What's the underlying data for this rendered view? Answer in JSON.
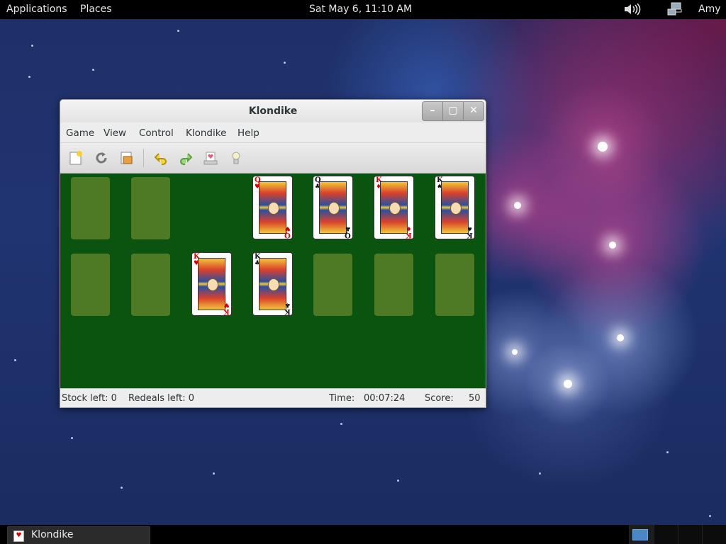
{
  "topbar": {
    "applications": "Applications",
    "places": "Places",
    "clock": "Sat May  6, 11:10 AM",
    "user": "Amy",
    "volume_icon": "volume-icon",
    "network_icon": "network-icon"
  },
  "window": {
    "title": "Klondike",
    "controls": {
      "minimize": "–",
      "maximize": "▢",
      "close": "✕"
    },
    "menu": [
      "Game",
      "View",
      "Control",
      "Klondike",
      "Help"
    ],
    "toolbar": [
      "new-game-icon",
      "restart-icon",
      "select-game-icon",
      "undo-icon",
      "redo-icon",
      "deal-icon",
      "hint-icon"
    ],
    "cards": {
      "foundation_1": {
        "rank": "Q",
        "suit": "♥",
        "color": "red"
      },
      "foundation_2": {
        "rank": "Q",
        "suit": "♣",
        "color": "black"
      },
      "foundation_3": {
        "rank": "K",
        "suit": "♦",
        "color": "red"
      },
      "foundation_4": {
        "rank": "K",
        "suit": "♠",
        "color": "black"
      },
      "tableau_3": {
        "rank": "K",
        "suit": "♥",
        "color": "red"
      },
      "tableau_4": {
        "rank": "K",
        "suit": "♣",
        "color": "black"
      }
    },
    "status": {
      "stock": "Stock left: 0",
      "redeals": "Redeals left: 0",
      "time_label": "Time:",
      "time": "00:07:24",
      "score_label": "Score:",
      "score": "50"
    }
  },
  "taskbar": {
    "task_label": "Klondike",
    "workspaces": 4,
    "active_workspace": 1
  },
  "colors": {
    "felt": "#0b5410",
    "empty_slot": "#4e7a26",
    "panel": "#000000"
  }
}
